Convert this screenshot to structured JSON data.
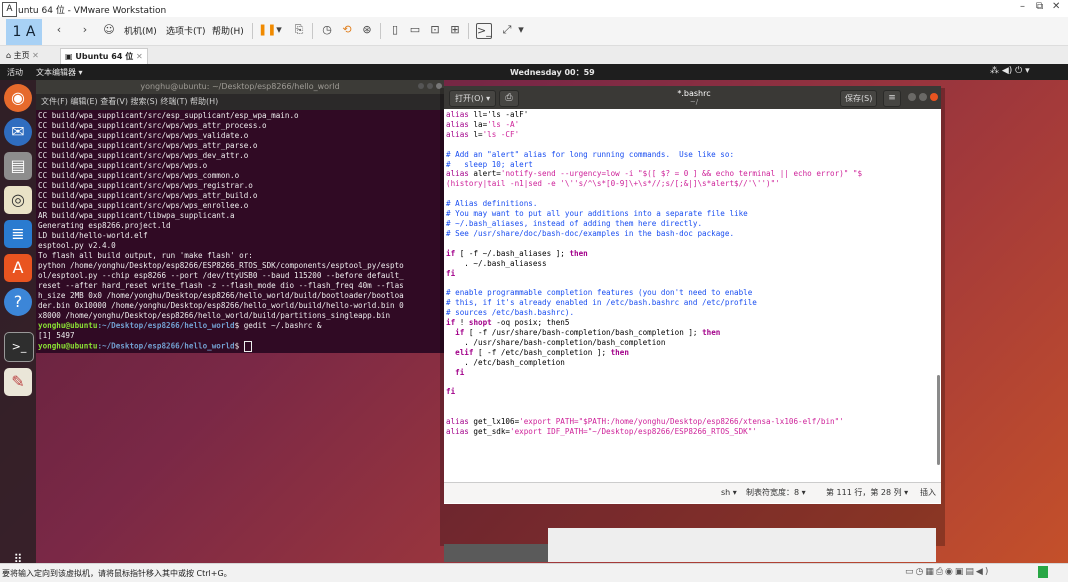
{
  "vmware": {
    "ime_badge": "A",
    "ime_floating": "1 A",
    "title": "untu 64 位 - VMware Workstation",
    "menu": [
      "机机(M)",
      "选项卡(T)",
      "帮助(H)"
    ],
    "tabs": [
      {
        "label": "主页"
      },
      {
        "label": "Ubuntu 64 位"
      }
    ],
    "status_message": "要将输入定向到该虚拟机，请将鼠标指针移入其中或按 Ctrl+G。",
    "window_controls": [
      "–",
      "⧉",
      "✕"
    ]
  },
  "ubuntu": {
    "activities": "活动",
    "app_menu": "文本编辑器 ▾",
    "clock": "Wednesday 00：59",
    "status_icons": "⁂ ◀) ⏻ ▾"
  },
  "terminal": {
    "title": "yonghu@ubuntu: ~/Desktop/esp8266/hello_world",
    "menu": "文件(F)  编辑(E)  查看(V)  搜索(S)  终端(T)  帮助(H)",
    "lines": [
      "CC build/wpa_supplicant/src/esp_supplicant/esp_wpa_main.o",
      "CC build/wpa_supplicant/src/wps/wps_attr_process.o",
      "CC build/wpa_supplicant/src/wps/wps_validate.o",
      "CC build/wpa_supplicant/src/wps/wps_attr_parse.o",
      "CC build/wpa_supplicant/src/wps/wps_dev_attr.o",
      "CC build/wpa_supplicant/src/wps/wps.o",
      "CC build/wpa_supplicant/src/wps/wps_common.o",
      "CC build/wpa_supplicant/src/wps/wps_registrar.o",
      "CC build/wpa_supplicant/src/wps/wps_attr_build.o",
      "CC build/wpa_supplicant/src/wps/wps_enrollee.o",
      "AR build/wpa_supplicant/libwpa_supplicant.a",
      "Generating esp8266.project.ld",
      "LD build/hello-world.elf",
      "esptool.py v2.4.0",
      "To flash all build output, run 'make flash' or:",
      "python /home/yonghu/Desktop/esp8266/ESP8266_RTOS_SDK/components/esptool_py/espto",
      "ol/esptool.py --chip esp8266 --port /dev/ttyUSB0 --baud 115200 --before default_",
      "reset --after hard_reset write_flash -z --flash_mode dio --flash_freq 40m --flas",
      "h_size 2MB 0x0 /home/yonghu/Desktop/esp8266/hello_world/build/bootloader/bootloa",
      "der.bin 0x10000 /home/yonghu/Desktop/esp8266/hello_world/build/hello-world.bin 0",
      "x8000 /home/yonghu/Desktop/esp8266/hello_world/build/partitions_singleapp.bin"
    ],
    "prompt_user": "yonghu@ubuntu",
    "prompt_path": ":~/Desktop/esp8266/hello_world",
    "command": "$ gedit ~/.bashrc &",
    "job_line": "[1] 5497",
    "prompt2_tail": "$ "
  },
  "gedit": {
    "open_label": "打开(O) ▾",
    "title": "*.bashrc",
    "subtitle": "~/",
    "save_label": "保存(S)",
    "status": {
      "lang": "sh ▾",
      "tab_width": "制表符宽度：8 ▾",
      "position": "第 111 行，第 28 列 ▾",
      "mode": "插入"
    }
  }
}
